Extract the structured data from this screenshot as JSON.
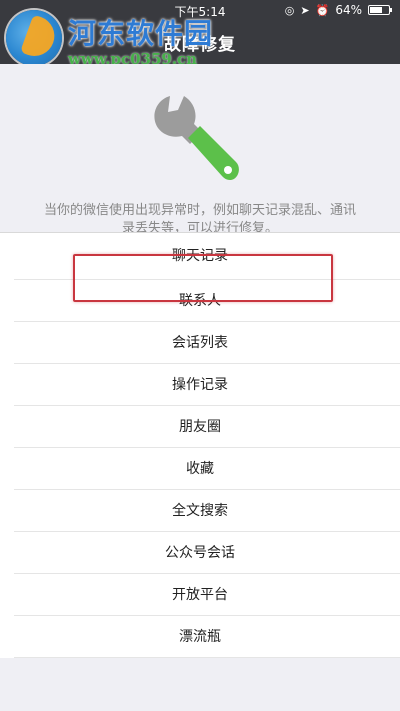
{
  "status_bar": {
    "time": "下午5:14",
    "battery": "64%",
    "battery_level": 0.64
  },
  "watermark": {
    "name": "河东软件园",
    "url": "www.pc0359.cn"
  },
  "header": {
    "title": "故障修复"
  },
  "hero": {
    "icon": "wrench-icon",
    "description": "当你的微信使用出现异常时，例如聊天记录混乱、通讯录丢失等，可以进行修复。"
  },
  "colors": {
    "nav_bg": "#393a3f",
    "page_bg": "#efeff4",
    "wrench_green": "#5cc04a",
    "wrench_gray": "#9c9c9c",
    "highlight_red": "#c9363f"
  },
  "repair_items": [
    {
      "label": "聊天记录"
    },
    {
      "label": "联系人"
    },
    {
      "label": "会话列表"
    },
    {
      "label": "操作记录"
    },
    {
      "label": "朋友圈"
    },
    {
      "label": "收藏"
    },
    {
      "label": "全文搜索"
    },
    {
      "label": "公众号会话"
    },
    {
      "label": "开放平台"
    },
    {
      "label": "漂流瓶"
    }
  ]
}
